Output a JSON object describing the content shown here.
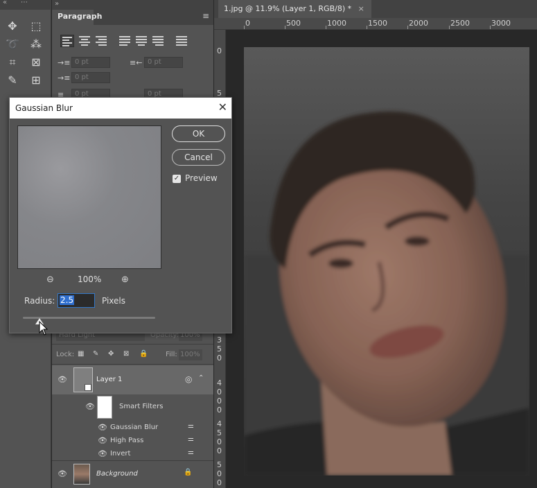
{
  "panel": {
    "tab_label": "Paragraph",
    "menu_icon": "≡",
    "indent_fields": [
      "0 pt",
      "0 pt",
      "0 pt",
      "0 pt",
      "0 pt"
    ]
  },
  "document": {
    "tab_title": "1.jpg @ 11.9% (Layer 1, RGB/8) *",
    "close": "×",
    "ruler_top": [
      "0",
      "500",
      "1000",
      "1500",
      "2000",
      "2500",
      "3000"
    ],
    "ruler_left": [
      "0",
      "5",
      "3\n5\n0",
      "4\n0\n0\n0",
      "4\n5\n0\n0",
      "5\n0\n0"
    ]
  },
  "dialog": {
    "title": "Gaussian Blur",
    "close": "✕",
    "ok_label": "OK",
    "cancel_label": "Cancel",
    "preview_label": "Preview",
    "preview_checked": true,
    "zoom_value": "100%",
    "radius_label": "Radius:",
    "radius_value": "2.5",
    "radius_unit": "Pixels"
  },
  "layers": {
    "blend_mode": "Hard Light",
    "opacity_label": "Opacity:",
    "opacity_value": "100%",
    "lock_label": "Lock:",
    "fill_label": "Fill:",
    "fill_value": "100%",
    "items": [
      {
        "name": "Layer 1"
      },
      {
        "name": "Smart Filters"
      },
      {
        "name": "Gaussian Blur"
      },
      {
        "name": "High Pass"
      },
      {
        "name": "Invert"
      },
      {
        "name": "Background"
      }
    ]
  }
}
